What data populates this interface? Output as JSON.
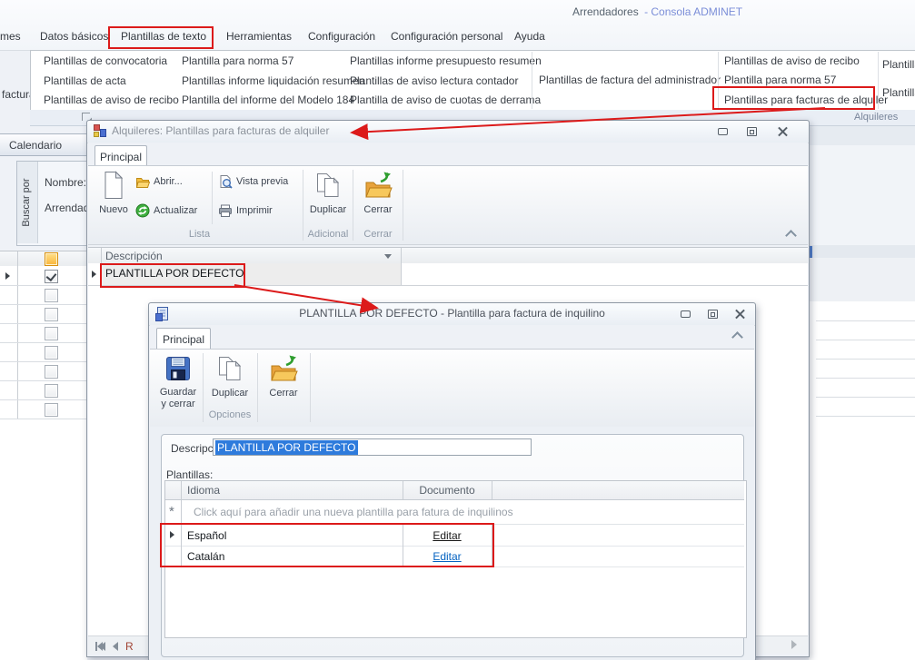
{
  "titlebar": {
    "app_title_left": "Arrendadores",
    "app_title_right": "- Consola ADMINET"
  },
  "menubar": {
    "items": [
      {
        "label": "mes"
      },
      {
        "label": "Datos básicos"
      },
      {
        "label": "Plantillas de texto"
      },
      {
        "label": "Herramientas"
      },
      {
        "label": "Configuración"
      },
      {
        "label": "Configuración personal"
      },
      {
        "label": "Ayuda"
      }
    ]
  },
  "ribbon_popup": {
    "left_fragment": "factura",
    "columns": [
      {
        "items": [
          "Plantillas de convocatoria",
          "Plantillas de acta",
          "Plantillas de aviso de recibo"
        ]
      },
      {
        "items": [
          "Plantilla para norma 57",
          "Plantillas informe liquidación resumen",
          "Plantilla del informe del Modelo 184"
        ]
      },
      {
        "items": [
          "Plantillas informe presupuesto resumen",
          "Plantillas de aviso lectura contador",
          "Plantilla de aviso de cuotas de derrama"
        ]
      },
      {
        "items": [
          "Plantillas de factura del administrador"
        ]
      },
      {
        "items": [
          "Plantillas de aviso de recibo",
          "Plantilla para norma 57",
          "Plantillas para facturas de alquiler"
        ]
      },
      {
        "items": [
          "Plantilla",
          "Plantilla"
        ]
      }
    ],
    "group_label": "Alquileres"
  },
  "background": {
    "calendar_tab": "Calendario",
    "search_group": {
      "vertical_label": "Buscar por",
      "name_label": "Nombre:",
      "owner_label": "Arrendador"
    }
  },
  "window1": {
    "title": "Alquileres: Plantillas para facturas de alquiler",
    "tab": "Principal",
    "ribbon": {
      "nuevo": "Nuevo",
      "abrir": "Abrir...",
      "actualizar": "Actualizar",
      "vista_previa": "Vista previa",
      "imprimir": "Imprimir",
      "duplicar": "Duplicar",
      "cerrar": "Cerrar",
      "group_lista": "Lista",
      "group_adicional": "Adicional",
      "group_cerrar": "Cerrar"
    },
    "grid": {
      "header": "Descripción",
      "row1": "PLANTILLA POR DEFECTO"
    },
    "nav_fragment": "R"
  },
  "window2": {
    "title": "PLANTILLA POR DEFECTO - Plantilla para factura de inquilino",
    "tab": "Principal",
    "ribbon": {
      "guardar": "Guardar y cerrar",
      "duplicar": "Duplicar",
      "cerrar": "Cerrar",
      "group_opciones": "Opciones"
    },
    "form": {
      "descripcion_label": "Descripción:",
      "descripcion_value": "PLANTILLA POR DEFECTO",
      "plantillas_label": "Plantillas:"
    },
    "grid": {
      "col_idioma": "Idioma",
      "col_documento": "Documento",
      "new_row_hint": "Click aquí para añadir una nueva plantilla para fatura de inquilinos",
      "rows": [
        {
          "idioma": "Español",
          "documento": "Editar"
        },
        {
          "idioma": "Catalán",
          "documento": "Editar"
        }
      ]
    }
  },
  "icons": {
    "filter_dropdown": "▾",
    "new_row_marker": "*"
  },
  "colors": {
    "annotation_red": "#dc1a1a",
    "selection_blue": "#2e7bdc",
    "link_blue": "#0563c1",
    "link_dark": "#1a1a1a",
    "title_accent": "#7b8ed8"
  }
}
